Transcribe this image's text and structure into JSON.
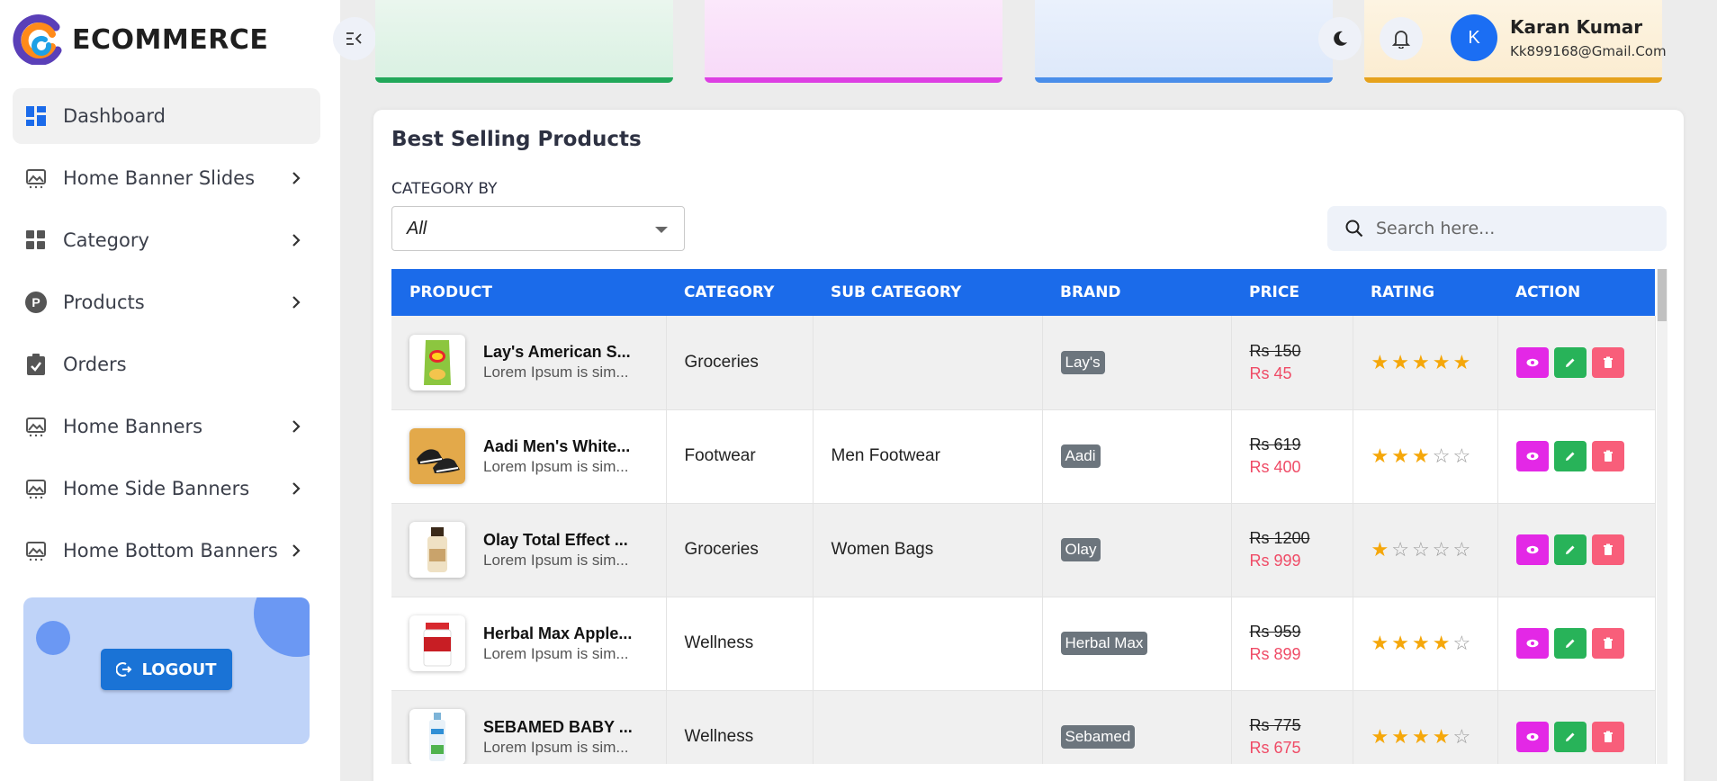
{
  "brand": {
    "name": "ECOMMERCE"
  },
  "colors": {
    "primary": "#1b6bea",
    "sidebar_active": "#f1f1f1",
    "price_sale": "#ef4b66",
    "star": "#f5a70a"
  },
  "sidebar": {
    "items": [
      {
        "label": "Dashboard",
        "icon": "dashboard-icon",
        "active": true,
        "has_submenu": false
      },
      {
        "label": "Home Banner Slides",
        "icon": "image-icon",
        "has_submenu": true
      },
      {
        "label": "Category",
        "icon": "grid-icon",
        "has_submenu": true
      },
      {
        "label": "Products",
        "icon": "products-icon",
        "has_submenu": true
      },
      {
        "label": "Orders",
        "icon": "clipboard-check-icon",
        "has_submenu": false
      },
      {
        "label": "Home Banners",
        "icon": "image-icon",
        "has_submenu": true
      },
      {
        "label": "Home Side Banners",
        "icon": "image-icon",
        "has_submenu": true
      },
      {
        "label": "Home Bottom Banners",
        "icon": "image-icon",
        "has_submenu": true
      }
    ],
    "logout_label": "LOGOUT"
  },
  "header": {
    "user": {
      "initial": "K",
      "name": "Karan Kumar",
      "email": "Kk899168@Gmail.Com"
    }
  },
  "section": {
    "title": "Best Selling Products",
    "category_label": "CATEGORY BY",
    "category_value": "All",
    "search_placeholder": "Search here..."
  },
  "table": {
    "columns": [
      "PRODUCT",
      "CATEGORY",
      "SUB CATEGORY",
      "BRAND",
      "PRICE",
      "RATING",
      "ACTION"
    ],
    "rows": [
      {
        "name": "Lay's American S...",
        "desc": "Lorem Ipsum is sim...",
        "category": "Groceries",
        "sub_category": "",
        "brand": "Lay's",
        "old_price": "Rs 150",
        "new_price": "Rs 45",
        "rating": 5,
        "image": "chips-bag"
      },
      {
        "name": "Aadi Men's White...",
        "desc": "Lorem Ipsum is sim...",
        "category": "Footwear",
        "sub_category": "Men Footwear",
        "brand": "Aadi",
        "old_price": "Rs 619",
        "new_price": "Rs 400",
        "rating": 3,
        "image": "shoes"
      },
      {
        "name": "Olay Total Effect ...",
        "desc": "Lorem Ipsum is sim...",
        "category": "Groceries",
        "sub_category": "Women Bags",
        "brand": "Olay",
        "old_price": "Rs 1200",
        "new_price": "Rs 999",
        "rating": 1,
        "image": "cream-bottle"
      },
      {
        "name": "Herbal Max Apple...",
        "desc": "Lorem Ipsum is sim...",
        "category": "Wellness",
        "sub_category": "",
        "brand": "Herbal Max",
        "old_price": "Rs 959",
        "new_price": "Rs 899",
        "rating": 4,
        "image": "supplement-jar"
      },
      {
        "name": "SEBAMED BABY ...",
        "desc": "Lorem Ipsum is sim...",
        "category": "Wellness",
        "sub_category": "",
        "brand": "Sebamed",
        "old_price": "Rs 775",
        "new_price": "Rs 675",
        "rating": 4,
        "image": "baby-lotion"
      }
    ]
  }
}
